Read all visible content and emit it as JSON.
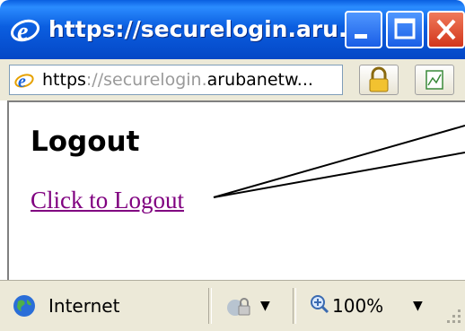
{
  "window": {
    "title": "https://securelogin.aru...",
    "title_icon": "ie-logo-icon"
  },
  "address_bar": {
    "scheme": "https",
    "sep": "://",
    "subdomain": "securelogin.",
    "domain": "arubanetw..."
  },
  "page": {
    "heading": "Logout",
    "link_label": "Click to Logout"
  },
  "status_bar": {
    "zone_label": "Internet",
    "zoom_label": "100%"
  },
  "colors": {
    "titlebar": "#0447c6",
    "link_visited": "#800080",
    "chrome": "#ece9d8"
  }
}
